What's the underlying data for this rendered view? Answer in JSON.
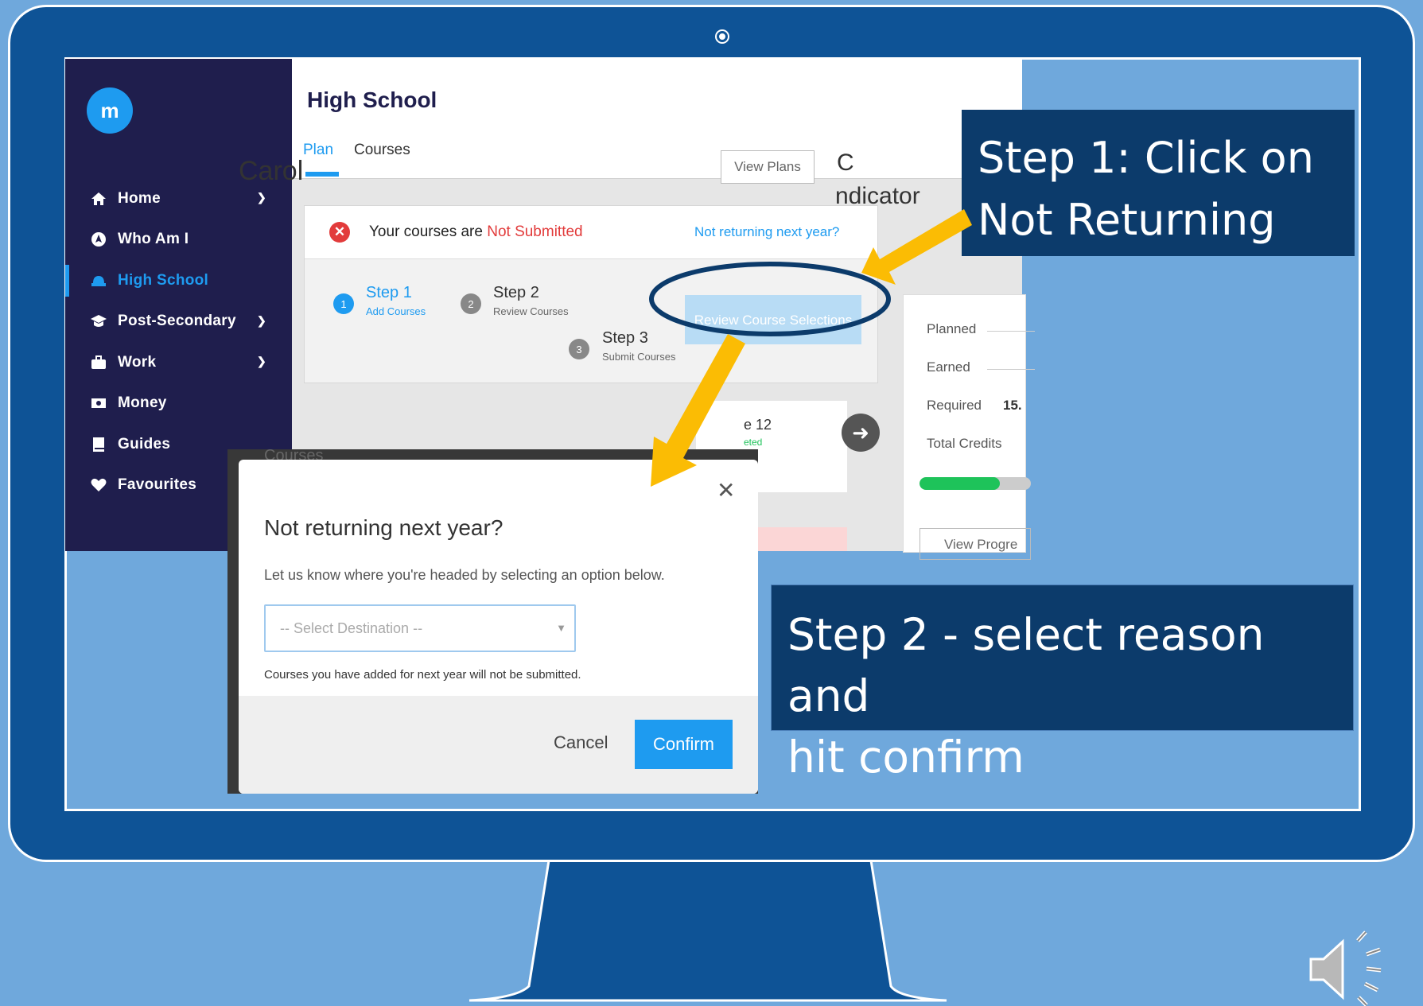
{
  "app": {
    "sidebar": {
      "items": [
        {
          "label": "Home",
          "icon": "home-icon",
          "has_chevron": true
        },
        {
          "label": "Who Am I",
          "icon": "compass-icon",
          "has_chevron": false
        },
        {
          "label": "High School",
          "icon": "hat-icon",
          "has_chevron": false,
          "active": true
        },
        {
          "label": "Post-Secondary",
          "icon": "graduation-cap-icon",
          "has_chevron": true
        },
        {
          "label": "Work",
          "icon": "briefcase-icon",
          "has_chevron": true
        },
        {
          "label": "Money",
          "icon": "money-icon",
          "has_chevron": false
        },
        {
          "label": "Guides",
          "icon": "book-icon",
          "has_chevron": false
        },
        {
          "label": "Favourites",
          "icon": "heart-icon",
          "has_chevron": false
        }
      ]
    },
    "header": {
      "title": "High School",
      "tabs": [
        "Plan",
        "Courses"
      ]
    },
    "student_name": "Carol",
    "view_plans_label": "View Plans",
    "indicator_fragment": "ndicator",
    "status": {
      "prefix": "Your courses are",
      "state": "Not Submitted",
      "not_returning_link": "Not returning next year?"
    },
    "steps": [
      {
        "number": "1",
        "title": "Step 1",
        "subtitle": "Add Courses"
      },
      {
        "number": "2",
        "title": "Step 2",
        "subtitle": "Review Courses"
      },
      {
        "number": "3",
        "title": "Step 3",
        "subtitle": "Submit Courses"
      }
    ],
    "review_button_label": "Review Course Selections",
    "credits": {
      "planned": "Planned",
      "earned": "Earned",
      "required": "Required",
      "required_value": "15.",
      "total": "Total Credits",
      "progress": 0.72
    },
    "view_progress_label": "View Progre",
    "grade_label": "e 12",
    "completed_label": "eted",
    "shadow_label": "Courses"
  },
  "modal": {
    "title": "Not returning next year?",
    "description": "Let us know where you're headed by selecting an option below.",
    "select_placeholder": "-- Select Destination --",
    "note": "Courses you have added for next year will not be submitted.",
    "cancel_label": "Cancel",
    "confirm_label": "Confirm"
  },
  "callouts": {
    "step1_line1": "Step 1: Click on",
    "step1_line2": "Not Returning",
    "step2_line1": "Step 2 - select reason and",
    "step2_line2": "hit confirm"
  },
  "colors": {
    "background": "#6fa8dc",
    "monitor": "#0e5396",
    "callout": "#0c3b6b",
    "accent": "#1e9bf0",
    "arrow": "#fbbc04",
    "sidebar": "#1f1e4d"
  }
}
